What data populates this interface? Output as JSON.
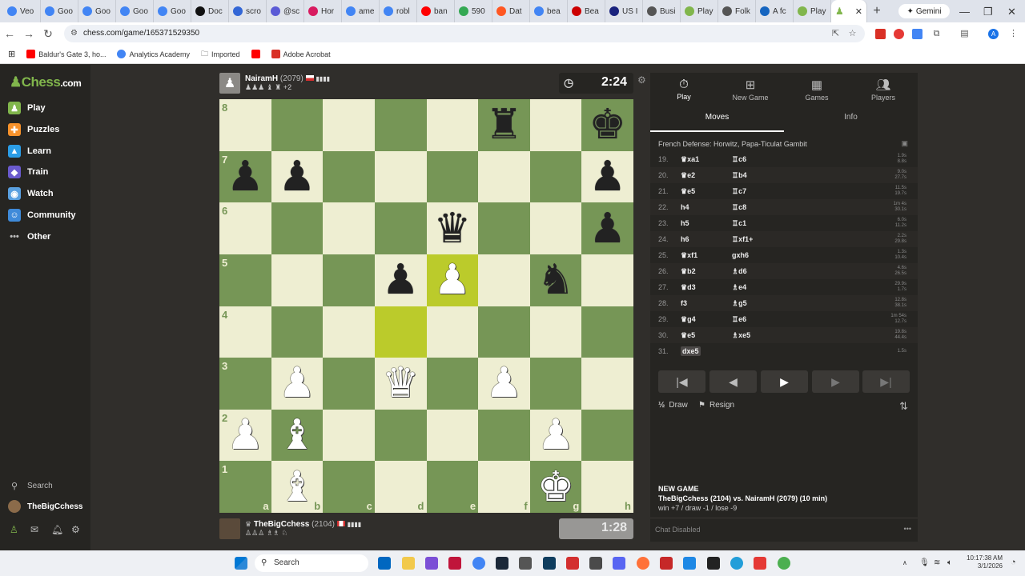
{
  "browser": {
    "tabs": [
      {
        "label": "Veo",
        "color": "#4285f4"
      },
      {
        "label": "Goo",
        "color": "#4285f4"
      },
      {
        "label": "Goo",
        "color": "#4285f4"
      },
      {
        "label": "Goo",
        "color": "#4285f4"
      },
      {
        "label": "Goo",
        "color": "#4285f4"
      },
      {
        "label": "Doc",
        "color": "#111111"
      },
      {
        "label": "scro",
        "color": "#3367d6"
      },
      {
        "label": "@sc",
        "color": "#5b5bd6"
      },
      {
        "label": "Hor",
        "color": "#d81b60"
      },
      {
        "label": "ame",
        "color": "#4285f4"
      },
      {
        "label": "robl",
        "color": "#4285f4"
      },
      {
        "label": "ban",
        "color": "#ff0000"
      },
      {
        "label": "590",
        "color": "#34a853"
      },
      {
        "label": "Dat",
        "color": "#ff5722"
      },
      {
        "label": "bea",
        "color": "#4285f4"
      },
      {
        "label": "Bea",
        "color": "#cc0000"
      },
      {
        "label": "US I",
        "color": "#1a237e"
      },
      {
        "label": "Busi",
        "color": "#555555"
      },
      {
        "label": "Play",
        "color": "#81b64c"
      },
      {
        "label": "Folk",
        "color": "#555555"
      },
      {
        "label": "A fc",
        "color": "#1565c0"
      },
      {
        "label": "Play",
        "color": "#81b64c"
      }
    ],
    "active_tab_icon": "pawn-icon",
    "new_tab": "+",
    "gemini_label": "Gemini",
    "url": "chess.com/game/165371529350",
    "bookmarks": [
      "Baldur's Gate 3, ho...",
      "Analytics Academy",
      "Imported",
      "",
      "Adobe Acrobat"
    ]
  },
  "sidebar": {
    "logo_a": "Chess",
    "logo_b": ".com",
    "items": [
      "Play",
      "Puzzles",
      "Learn",
      "Train",
      "Watch",
      "Community",
      "Other"
    ],
    "search": "Search",
    "user": "TheBigCchess"
  },
  "game": {
    "top_player": {
      "name": "NairamH",
      "rating": "(2079)",
      "captured": "♟♟♟ ♝ ♜ +2",
      "clock": "2:24"
    },
    "bottom_player": {
      "name": "TheBigCchess",
      "rating": "(2104)",
      "captured": "♙♙♙ ♗♗ ♘",
      "clock": "1:28"
    },
    "files": [
      "a",
      "b",
      "c",
      "d",
      "e",
      "f",
      "g",
      "h"
    ],
    "ranks": [
      "8",
      "7",
      "6",
      "5",
      "4",
      "3",
      "2",
      "1"
    ],
    "board": [
      [
        "",
        "",
        "",
        "",
        "",
        "bR",
        "",
        "bK"
      ],
      [
        "bP",
        "bP",
        "",
        "",
        "",
        "",
        "",
        "bP"
      ],
      [
        "",
        "",
        "",
        "",
        "bQ",
        "",
        "",
        "bP"
      ],
      [
        "",
        "",
        "",
        "bP",
        "wP",
        "",
        "bN",
        ""
      ],
      [
        "",
        "",
        "",
        "",
        "",
        "",
        "",
        ""
      ],
      [
        "",
        "wP",
        "",
        "wQ",
        "",
        "wP",
        "",
        ""
      ],
      [
        "wP",
        "wB",
        "",
        "",
        "",
        "",
        "wP",
        ""
      ],
      [
        "",
        "wB",
        "",
        "",
        "",
        "",
        "wK",
        ""
      ]
    ],
    "highlight": [
      "d4",
      "e5"
    ]
  },
  "panel": {
    "tabs": [
      {
        "label": "Play",
        "icon": "stopwatch-icon"
      },
      {
        "label": "New Game",
        "icon": "plus-icon"
      },
      {
        "label": "Games",
        "icon": "board-icon"
      },
      {
        "label": "Players",
        "icon": "players-icon"
      }
    ],
    "subtabs": [
      "Moves",
      "Info"
    ],
    "opening": "French Defense: Horwitz, Papa-Ticulat Gambit",
    "moves": [
      {
        "n": "19.",
        "w": "♛xa1",
        "b": "♖c6",
        "tw": "1.9s",
        "tb": "8.8s"
      },
      {
        "n": "20.",
        "w": "♛e2",
        "b": "♖b4",
        "tw": "9.0s",
        "tb": "27.7s"
      },
      {
        "n": "21.",
        "w": "♛e5",
        "b": "♖c7",
        "tw": "11.5s",
        "tb": "19.7s"
      },
      {
        "n": "22.",
        "w": "h4",
        "b": "♖c8",
        "tw": "1m 4s",
        "tb": "30.1s"
      },
      {
        "n": "23.",
        "w": "h5",
        "b": "♖c1",
        "tw": "6.0s",
        "tb": "11.2s"
      },
      {
        "n": "24.",
        "w": "h6",
        "b": "♖xf1+",
        "tw": "2.2s",
        "tb": "29.8s"
      },
      {
        "n": "25.",
        "w": "♛xf1",
        "b": "gxh6",
        "tw": "1.3s",
        "tb": "10.4s"
      },
      {
        "n": "26.",
        "w": "♛b2",
        "b": "♗d6",
        "tw": "4.6s",
        "tb": "26.5s"
      },
      {
        "n": "27.",
        "w": "♛d3",
        "b": "♗e4",
        "tw": "29.9s",
        "tb": "1.7s"
      },
      {
        "n": "28.",
        "w": "f3",
        "b": "♗g5",
        "tw": "12.8s",
        "tb": "38.1s"
      },
      {
        "n": "29.",
        "w": "♛g4",
        "b": "♖e6",
        "tw": "1m 54s",
        "tb": "12.7s"
      },
      {
        "n": "30.",
        "w": "♛e5",
        "b": "♗xe5",
        "tw": "19.8s",
        "tb": "44.4s"
      },
      {
        "n": "31.",
        "w": "dxe5",
        "b": "",
        "tw": "1.5s",
        "tb": ""
      }
    ],
    "controls": [
      "|◀",
      "◀",
      "▶",
      "▶",
      "▶|"
    ],
    "draw": "Draw",
    "resign": "Resign",
    "new_game_title": "NEW GAME",
    "new_game_line": "TheBigCchess (2104) vs. NairamH (2079) (10 min)",
    "new_game_stats": "win +7 / draw -1 / lose -9",
    "chat": "Chat Disabled"
  },
  "taskbar": {
    "search": "Search",
    "time": "10:17:38 AM",
    "date": "3/1/2026"
  }
}
